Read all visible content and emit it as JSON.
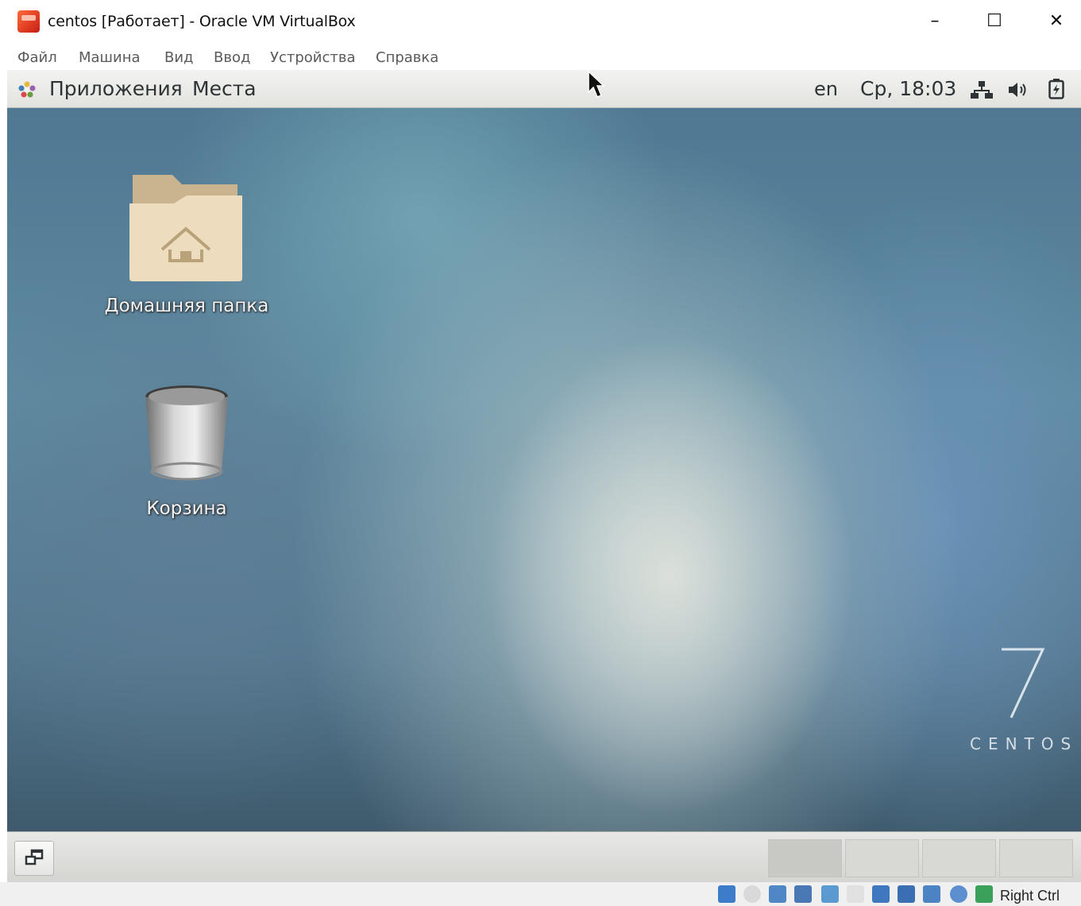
{
  "window": {
    "title": "centos [Работает] - Oracle VM VirtualBox",
    "controls": {
      "minimize": "–",
      "maximize": "☐",
      "close": "✕"
    }
  },
  "menubar": {
    "items": [
      "Файл",
      "Машина",
      "Вид",
      "Ввод",
      "Устройства",
      "Справка"
    ]
  },
  "gnome_topbar": {
    "applications": "Приложения",
    "places": "Места",
    "language": "en",
    "clock": "Ср, 18:03",
    "status_icons": [
      "network-icon",
      "volume-icon",
      "battery-icon"
    ]
  },
  "desktop": {
    "icons": [
      {
        "name": "home-folder-icon",
        "label": "Домашняя папка"
      },
      {
        "name": "trash-icon",
        "label": "Корзина"
      }
    ],
    "wallpaper_logo": {
      "number": "7",
      "word": "CENTOS"
    }
  },
  "gnome_bottombar": {
    "show_desktop_icon": "window-list-icon",
    "workspaces": 4,
    "active_workspace": 1
  },
  "vbox_statusbar": {
    "icons": [
      "hard-disk-icon",
      "optical-drive-icon",
      "audio-icon",
      "network-adapter-icon",
      "usb-icon",
      "shared-folders-icon",
      "display-icon",
      "video-capture-icon",
      "vm-icon",
      "cpu-icon",
      "mouse-integration-icon"
    ],
    "host_key": "Right Ctrl"
  },
  "colors": {
    "wallpaper_base": "#5a7e95",
    "panel": "#e2e2df",
    "app_icon": "#d7301f"
  }
}
